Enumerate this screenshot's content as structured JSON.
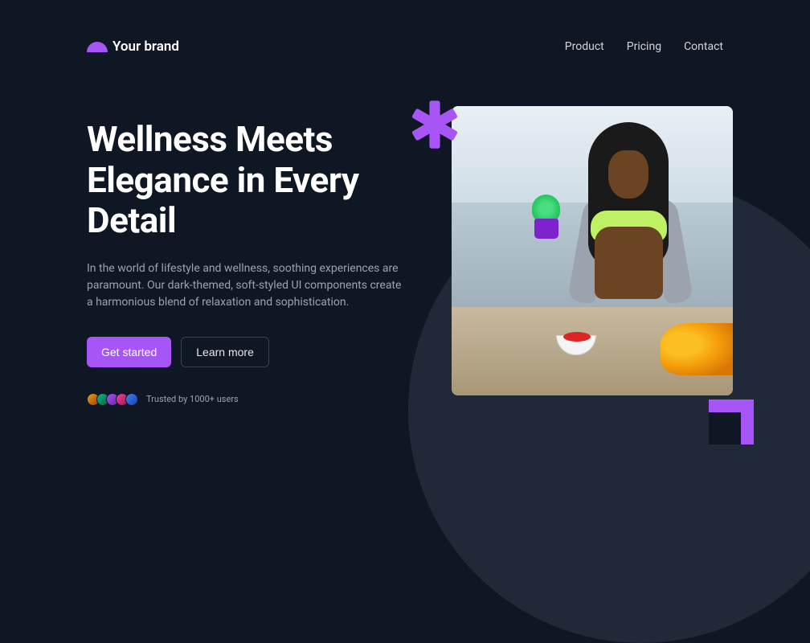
{
  "brand": {
    "name": "Your brand"
  },
  "nav": {
    "items": [
      "Product",
      "Pricing",
      "Contact"
    ]
  },
  "hero": {
    "heading": "Wellness Meets Elegance in Every Detail",
    "subtext": "In the world of lifestyle and wellness, soothing experiences are paramount. Our dark-themed, soft-styled UI components create a harmonious blend of relaxation and sophistication.",
    "cta_primary": "Get started",
    "cta_secondary": "Learn more",
    "trusted_text": "Trusted by 1000+ users"
  },
  "colors": {
    "accent": "#a855f7",
    "background": "#0f1724"
  }
}
